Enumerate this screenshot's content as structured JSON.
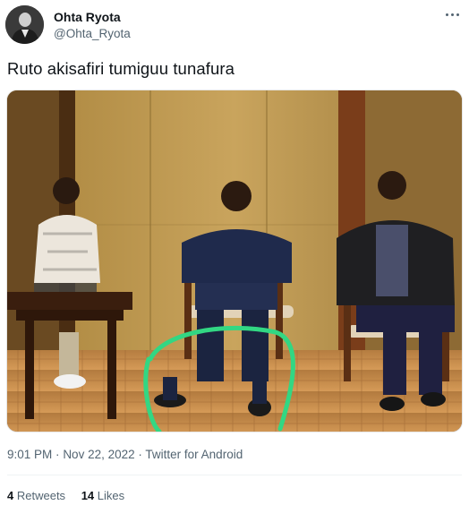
{
  "author": {
    "display_name": "Ohta Ryota",
    "handle": "@Ohta_Ryota",
    "avatar_icon": "user-avatar"
  },
  "menu_icon": "more-dots-icon",
  "tweet": {
    "text": "Ruto akisafiri tumiguu tunafura"
  },
  "meta": {
    "time": "9:01 PM",
    "separator": "·",
    "date": "Nov 22, 2022",
    "source": "Twitter for Android"
  },
  "stats": {
    "retweets_count": "4",
    "retweets_label": "Retweets",
    "likes_count": "14",
    "likes_label": "Likes"
  },
  "colors": {
    "text_primary": "#0f1419",
    "text_secondary": "#536471",
    "highlight_circle": "#32d783"
  }
}
